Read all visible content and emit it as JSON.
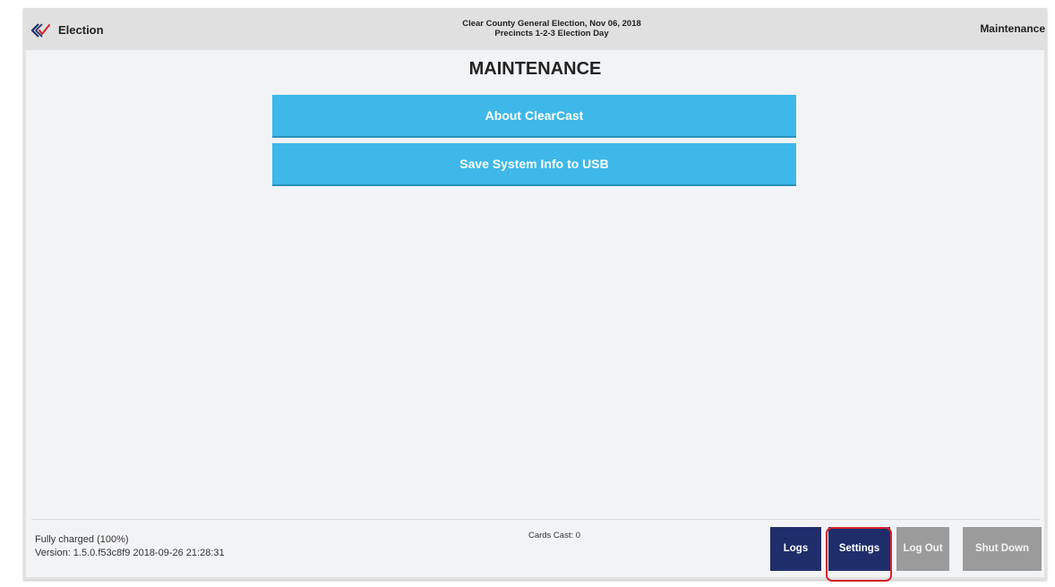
{
  "header": {
    "app_name": "Election",
    "election_title": "Clear County General Election, Nov 06, 2018",
    "precinct_line": "Precincts 1-2-3 Election Day",
    "screen_name": "Maintenance",
    "logo_icon": "checkmark-logo-icon",
    "logo_colors": [
      "#1f2e6b",
      "#d6222a"
    ]
  },
  "main": {
    "title": "MAINTENANCE",
    "buttons": [
      {
        "label": "About ClearCast"
      },
      {
        "label": "Save System Info to USB"
      }
    ],
    "button_color": "#3db8e8"
  },
  "footer": {
    "battery_status": "Fully charged (100%)",
    "version": "Version: 1.5.0.f53c8f9 2018-09-26 21:28:31",
    "cards_cast": "Cards Cast: 0",
    "buttons": [
      {
        "label": "Logs",
        "color": "#1f2e6b"
      },
      {
        "label": "Settings",
        "color": "#1f2e6b",
        "highlighted": true
      },
      {
        "label": "Log Out",
        "color": "#9b9b9b"
      },
      {
        "label": "Shut Down",
        "color": "#9b9b9b"
      }
    ],
    "highlight_color": "#d6222a"
  }
}
